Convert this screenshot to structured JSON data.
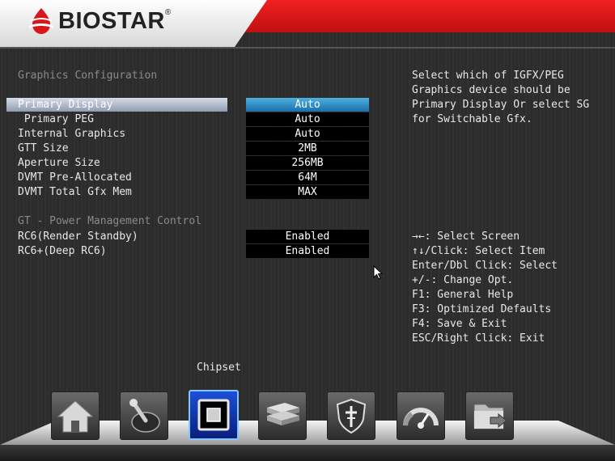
{
  "brand": {
    "name": "BIOSTAR",
    "reg": "®"
  },
  "section_graphics": "Graphics Configuration",
  "section_gt": "GT - Power Management Control",
  "settings": [
    {
      "label": "Primary Display",
      "value": "Auto"
    },
    {
      "label": " Primary PEG",
      "value": "Auto"
    },
    {
      "label": "Internal Graphics",
      "value": "Auto"
    },
    {
      "label": "GTT Size",
      "value": "2MB"
    },
    {
      "label": "Aperture Size",
      "value": "256MB"
    },
    {
      "label": "DVMT Pre-Allocated",
      "value": "64M"
    },
    {
      "label": "DVMT Total Gfx Mem",
      "value": "MAX"
    }
  ],
  "gt_settings": [
    {
      "label": "RC6(Render Standby)",
      "value": "Enabled"
    },
    {
      "label": "RC6+(Deep RC6)",
      "value": "Enabled"
    }
  ],
  "help_description": [
    "Select which of IGFX/PEG",
    "Graphics device should be",
    "Primary Display Or select SG",
    "for Switchable Gfx."
  ],
  "key_help": [
    "→←: Select Screen",
    "↑↓/Click: Select Item",
    "Enter/Dbl Click: Select",
    "+/-: Change Opt.",
    "F1: General Help",
    "F3: Optimized Defaults",
    "F4: Save & Exit",
    "ESC/Right Click: Exit"
  ],
  "active_tab": "Chipset",
  "dock": [
    {
      "icon": "home-icon"
    },
    {
      "icon": "joystick-icon"
    },
    {
      "icon": "chipset-icon"
    },
    {
      "icon": "boot-drives-icon"
    },
    {
      "icon": "security-shield-icon"
    },
    {
      "icon": "speedometer-icon"
    },
    {
      "icon": "folder-exit-icon"
    }
  ],
  "colors": {
    "header_red": "#e01818",
    "selected_value": "#2a8fcc"
  }
}
